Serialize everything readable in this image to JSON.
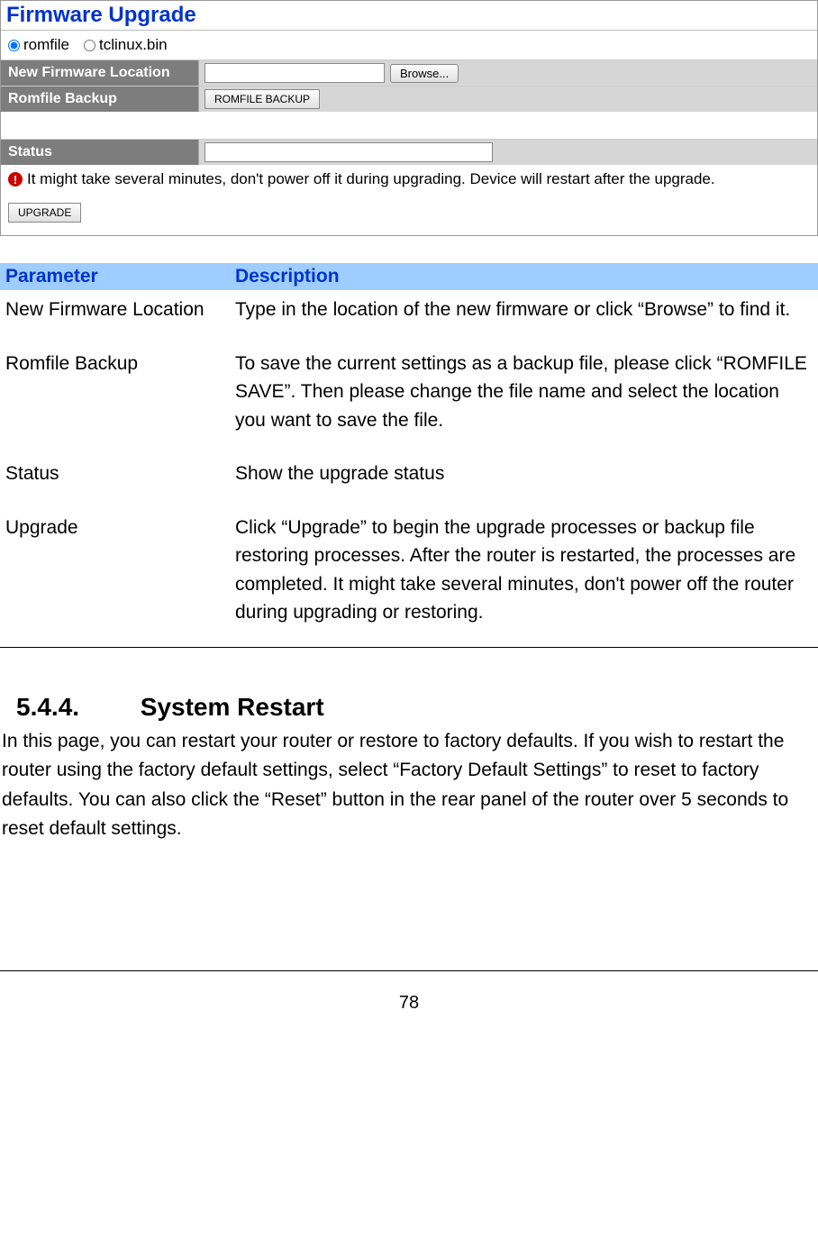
{
  "screenshot": {
    "title": "Firmware Upgrade",
    "radios": {
      "romfile": "romfile",
      "tclinux": "tclinux.bin"
    },
    "rows": {
      "newFirmware": {
        "label": "New Firmware Location",
        "browse": "Browse..."
      },
      "romfileBackup": {
        "label": "Romfile Backup",
        "button": "ROMFILE BACKUP"
      },
      "status": {
        "label": "Status"
      }
    },
    "warning": "It might take several minutes, don't power off it during upgrading. Device will restart after the upgrade.",
    "upgradeBtn": "UPGRADE"
  },
  "table": {
    "headers": {
      "param": "Parameter",
      "desc": "Description"
    },
    "rows": [
      {
        "param": "New Firmware Location",
        "desc": "Type in the location of the new firmware or click “Browse” to find it."
      },
      {
        "param": "Romfile Backup",
        "desc": "To save the current settings as a backup file, please click “ROMFILE SAVE”. Then please change the file name and select the location you want to save the file."
      },
      {
        "param": "Status",
        "desc": "Show the upgrade status"
      },
      {
        "param": "Upgrade",
        "desc": "Click “Upgrade” to begin the upgrade processes or backup file restoring processes. After the router is restarted, the processes are completed. It might take several minutes, don't power off the router during upgrading or restoring."
      }
    ]
  },
  "section": {
    "number": "5.4.4.",
    "title": "System Restart",
    "body": "In this page, you can restart your router or restore to factory defaults. If you wish to restart the router using the factory default settings, select “Factory Default Settings” to reset to factory defaults. You can also click the “Reset” button in the rear panel of the router over 5 seconds to reset default settings."
  },
  "pageNumber": "78"
}
